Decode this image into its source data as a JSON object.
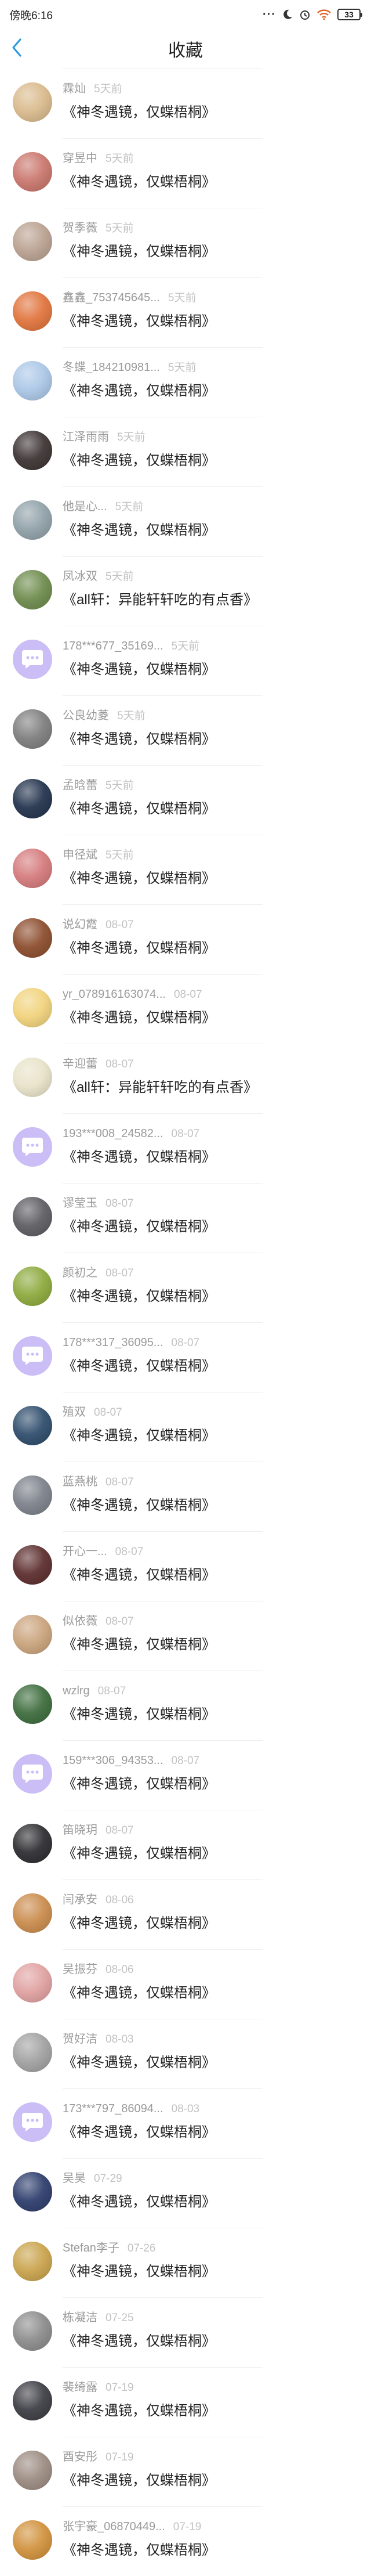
{
  "status_bar": {
    "time": "傍晚6:16",
    "battery": "33"
  },
  "header": {
    "title": "收藏",
    "back_icon": "chevron-left-icon"
  },
  "colors": {
    "accent": "#2f9ae0",
    "name": "#9a9a9a",
    "time": "#c2c2c2",
    "title": "#222222",
    "default_avatar": "#cbbdf5"
  },
  "favorites": [
    {
      "name": "霖灿",
      "time": "5天前",
      "title": "《神冬遇镜，仅蝶梧桐》",
      "avatar": "photo",
      "avatar_color": "#d9b98a"
    },
    {
      "name": "穿昱中",
      "time": "5天前",
      "title": "《神冬遇镜，仅蝶梧桐》",
      "avatar": "photo",
      "avatar_color": "#c8746a"
    },
    {
      "name": "贺季薇",
      "time": "5天前",
      "title": "《神冬遇镜，仅蝶梧桐》",
      "avatar": "photo",
      "avatar_color": "#b9a08f"
    },
    {
      "name": "鑫鑫_753745645...",
      "time": "5天前",
      "title": "《神冬遇镜，仅蝶梧桐》",
      "avatar": "photo",
      "avatar_color": "#e0723a"
    },
    {
      "name": "冬蝶_184210981...",
      "time": "5天前",
      "title": "《神冬遇镜，仅蝶梧桐》",
      "avatar": "photo",
      "avatar_color": "#a9c6e6"
    },
    {
      "name": "江泽雨雨",
      "time": "5天前",
      "title": "《神冬遇镜，仅蝶梧桐》",
      "avatar": "photo",
      "avatar_color": "#3a3030"
    },
    {
      "name": "他是心...",
      "time": "5天前",
      "title": "《神冬遇镜，仅蝶梧桐》",
      "avatar": "photo",
      "avatar_color": "#8fa0a8"
    },
    {
      "name": "凤冰双",
      "time": "5天前",
      "title": "《all轩：异能轩轩吃的有点香》",
      "avatar": "photo",
      "avatar_color": "#6c8a4a"
    },
    {
      "name": "178***677_35169...",
      "time": "5天前",
      "title": "《神冬遇镜，仅蝶梧桐》",
      "avatar": "default"
    },
    {
      "name": "公良幼菱",
      "time": "5天前",
      "title": "《神冬遇镜，仅蝶梧桐》",
      "avatar": "photo",
      "avatar_color": "#7c7c7c"
    },
    {
      "name": "孟晗蕾",
      "time": "5天前",
      "title": "《神冬遇镜，仅蝶梧桐》",
      "avatar": "photo",
      "avatar_color": "#1f2f4a"
    },
    {
      "name": "申径斌",
      "time": "5天前",
      "title": "《神冬遇镜，仅蝶梧桐》",
      "avatar": "photo",
      "avatar_color": "#d4787a"
    },
    {
      "name": "说幻霞",
      "time": "08-07",
      "title": "《神冬遇镜，仅蝶梧桐》",
      "avatar": "photo",
      "avatar_color": "#8a4a2a"
    },
    {
      "name": "yr_078916163074...",
      "time": "08-07",
      "title": "《神冬遇镜，仅蝶梧桐》",
      "avatar": "photo",
      "avatar_color": "#f1d27a"
    },
    {
      "name": "辛迎蕾",
      "time": "08-07",
      "title": "《all轩：异能轩轩吃的有点香》",
      "avatar": "photo",
      "avatar_color": "#e8e2c8"
    },
    {
      "name": "193***008_24582...",
      "time": "08-07",
      "title": "《神冬遇镜，仅蝶梧桐》",
      "avatar": "default"
    },
    {
      "name": "谬莹玉",
      "time": "08-07",
      "title": "《神冬遇镜，仅蝶梧桐》",
      "avatar": "photo",
      "avatar_color": "#5a5a60"
    },
    {
      "name": "颜初之",
      "time": "08-07",
      "title": "《神冬遇镜，仅蝶梧桐》",
      "avatar": "photo",
      "avatar_color": "#8ba83a"
    },
    {
      "name": "178***317_36095...",
      "time": "08-07",
      "title": "《神冬遇镜，仅蝶梧桐》",
      "avatar": "default"
    },
    {
      "name": "殖双",
      "time": "08-07",
      "title": "《神冬遇镜，仅蝶梧桐》",
      "avatar": "photo",
      "avatar_color": "#2b4a6a"
    },
    {
      "name": "蓝燕桃",
      "time": "08-07",
      "title": "《神冬遇镜，仅蝶梧桐》",
      "avatar": "photo",
      "avatar_color": "#7a7f88"
    },
    {
      "name": "开心一...",
      "time": "08-07",
      "title": "《神冬遇镜，仅蝶梧桐》",
      "avatar": "photo",
      "avatar_color": "#5a2a2a"
    },
    {
      "name": "似依薇",
      "time": "08-07",
      "title": "《神冬遇镜，仅蝶梧桐》",
      "avatar": "photo",
      "avatar_color": "#c9a27a"
    },
    {
      "name": "wzlrg",
      "time": "08-07",
      "title": "《神冬遇镜，仅蝶梧桐》",
      "avatar": "photo",
      "avatar_color": "#3a6a3a"
    },
    {
      "name": "159***306_94353...",
      "time": "08-07",
      "title": "《神冬遇镜，仅蝶梧桐》",
      "avatar": "default"
    },
    {
      "name": "笛晓玥",
      "time": "08-07",
      "title": "《神冬遇镜，仅蝶梧桐》",
      "avatar": "photo",
      "avatar_color": "#2a2a2e"
    },
    {
      "name": "闫承安",
      "time": "08-06",
      "title": "《神冬遇镜，仅蝶梧桐》",
      "avatar": "photo",
      "avatar_color": "#c98a4a"
    },
    {
      "name": "吴振芬",
      "time": "08-06",
      "title": "《神冬遇镜，仅蝶梧桐》",
      "avatar": "photo",
      "avatar_color": "#e0a0a0"
    },
    {
      "name": "贺好洁",
      "time": "08-03",
      "title": "《神冬遇镜，仅蝶梧桐》",
      "avatar": "photo",
      "avatar_color": "#a0a0a0"
    },
    {
      "name": "173***797_86094...",
      "time": "08-03",
      "title": "《神冬遇镜，仅蝶梧桐》",
      "avatar": "default"
    },
    {
      "name": "吴昊",
      "time": "07-29",
      "title": "《神冬遇镜，仅蝶梧桐》",
      "avatar": "photo",
      "avatar_color": "#2a3a6a"
    },
    {
      "name": "Stefan李子",
      "time": "07-26",
      "title": "《神冬遇镜，仅蝶梧桐》",
      "avatar": "photo",
      "avatar_color": "#c9a24a"
    },
    {
      "name": "栋凝洁",
      "time": "07-25",
      "title": "《神冬遇镜，仅蝶梧桐》",
      "avatar": "photo",
      "avatar_color": "#8a8a8a"
    },
    {
      "name": "裴绮露",
      "time": "07-19",
      "title": "《神冬遇镜，仅蝶梧桐》",
      "avatar": "photo",
      "avatar_color": "#3a3a42"
    },
    {
      "name": "酉安彤",
      "time": "07-19",
      "title": "《神冬遇镜，仅蝶梧桐》",
      "avatar": "photo",
      "avatar_color": "#9a8a80"
    },
    {
      "name": "张宇豪_06870449...",
      "time": "07-19",
      "title": "《神冬遇镜，仅蝶梧桐》",
      "avatar": "photo",
      "avatar_color": "#d0903a"
    }
  ]
}
